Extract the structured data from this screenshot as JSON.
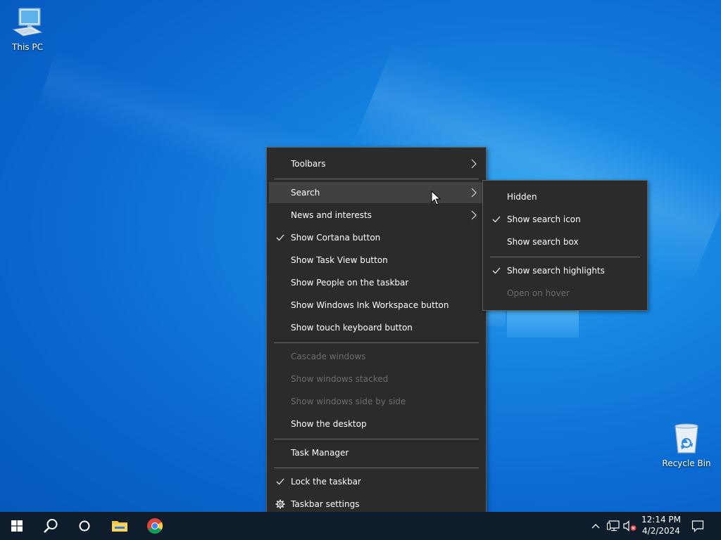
{
  "desktop": {
    "icons": [
      {
        "label": "This PC"
      },
      {
        "label": "Recycle Bin"
      }
    ]
  },
  "context_menu": {
    "items": [
      {
        "label": "Toolbars",
        "has_submenu": true
      },
      {
        "label": "Search",
        "has_submenu": true,
        "highlighted": true
      },
      {
        "label": "News and interests",
        "has_submenu": true
      },
      {
        "label": "Show Cortana button",
        "checked": true
      },
      {
        "label": "Show Task View button"
      },
      {
        "label": "Show People on the taskbar"
      },
      {
        "label": "Show Windows Ink Workspace button"
      },
      {
        "label": "Show touch keyboard button"
      },
      {
        "label": "Cascade windows",
        "disabled": true
      },
      {
        "label": "Show windows stacked",
        "disabled": true
      },
      {
        "label": "Show windows side by side",
        "disabled": true
      },
      {
        "label": "Show the desktop"
      },
      {
        "label": "Task Manager"
      },
      {
        "label": "Lock the taskbar",
        "checked": true
      },
      {
        "label": "Taskbar settings",
        "icon": "gear-icon"
      }
    ]
  },
  "search_submenu": {
    "items": [
      {
        "label": "Hidden"
      },
      {
        "label": "Show search icon",
        "checked": true
      },
      {
        "label": "Show search box"
      },
      {
        "label": "Show search highlights",
        "checked": true
      },
      {
        "label": "Open on hover",
        "disabled": true
      }
    ]
  },
  "taskbar": {
    "buttons": [
      {
        "icon": "windows-start-icon"
      },
      {
        "icon": "search-icon"
      },
      {
        "icon": "cortana-icon"
      },
      {
        "icon": "file-explorer-icon"
      },
      {
        "icon": "chrome-icon"
      }
    ],
    "tray_icons": [
      "chevron-up-icon",
      "network-icon",
      "volume-muted-icon",
      "notification-icon"
    ],
    "clock": {
      "time": "12:14 PM",
      "date": "4/2/2024"
    }
  },
  "colors": {
    "menu_bg": "#2b2b2b",
    "menu_hover": "#414141",
    "taskbar_bg": "#0f1c2b",
    "disabled_text": "#6d6d6d"
  }
}
